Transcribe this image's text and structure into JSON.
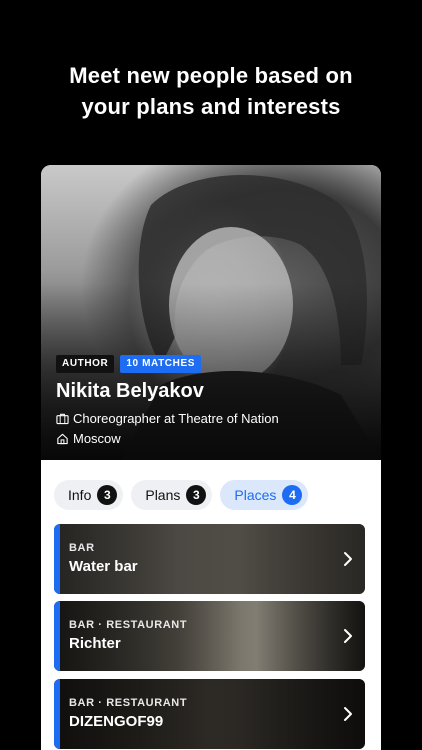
{
  "headline": {
    "line1": "Meet new people based on",
    "line2": "your plans and interests"
  },
  "profile": {
    "badges": [
      "AUTHOR",
      "10 MATCHES"
    ],
    "name": "Nikita Belyakov",
    "occupation": "Choreographer at Theatre of Nation",
    "occupation_icon": "briefcase-icon",
    "city": "Moscow",
    "city_icon": "home-icon"
  },
  "tabs": [
    {
      "label": "Info",
      "count": "3"
    },
    {
      "label": "Plans",
      "count": "3"
    },
    {
      "label": "Places",
      "count": "4",
      "active": true
    }
  ],
  "places": [
    {
      "category": "BAR",
      "name": "Water bar"
    },
    {
      "category": "BAR · RESTAURANT",
      "name": "Richter"
    },
    {
      "category": "BAR · RESTAURANT",
      "name": "DIZENGOF99"
    }
  ],
  "colors": {
    "accent": "#1e6cf2",
    "background": "#000000",
    "card": "#ffffff"
  }
}
